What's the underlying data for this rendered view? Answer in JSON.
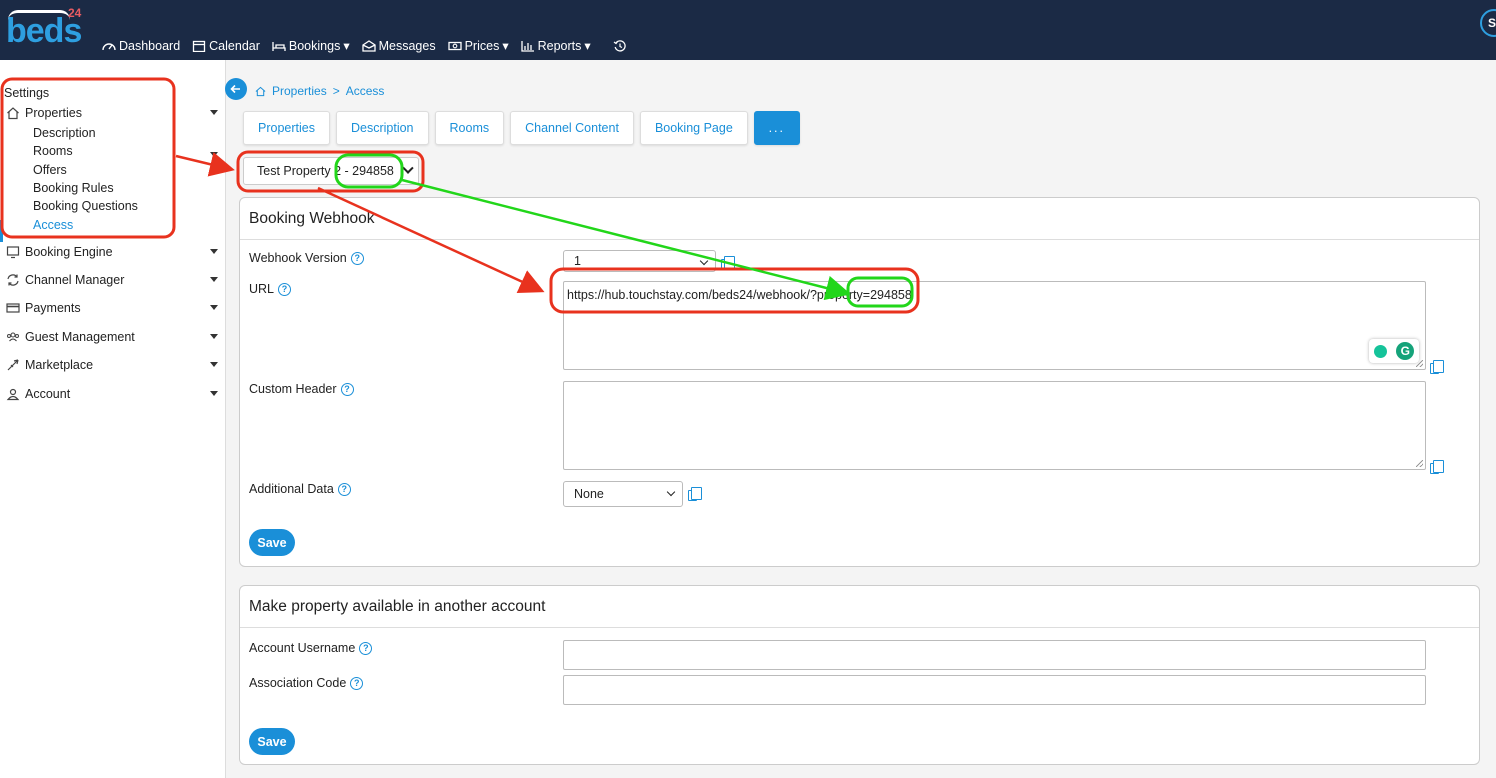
{
  "app": {
    "logo_text": "beds",
    "logo_sup": "24",
    "user_initial": "S"
  },
  "nav": {
    "dashboard": "Dashboard",
    "calendar": "Calendar",
    "bookings": "Bookings",
    "messages": "Messages",
    "prices": "Prices",
    "reports": "Reports"
  },
  "sidebar": {
    "settings": "Settings",
    "properties": "Properties",
    "sub": [
      "Description",
      "Rooms",
      "Offers",
      "Booking Rules",
      "Booking Questions",
      "Access"
    ],
    "booking_engine": "Booking Engine",
    "channel_manager": "Channel Manager",
    "payments": "Payments",
    "guest_management": "Guest Management",
    "marketplace": "Marketplace",
    "account": "Account"
  },
  "breadcrumb": {
    "properties": "Properties",
    "sep": ">",
    "access": "Access"
  },
  "tabs": [
    "Properties",
    "Description",
    "Rooms",
    "Channel Content",
    "Booking Page",
    "..."
  ],
  "property_select": {
    "label": "Test Property 2 - 294858"
  },
  "webhook": {
    "title": "Booking Webhook",
    "version_label": "Webhook Version",
    "version_value": "1",
    "url_label": "URL",
    "url_value": "https://hub.touchstay.com/beds24/webhook/?property=294858",
    "custom_header_label": "Custom Header",
    "additional_data_label": "Additional Data",
    "additional_data_value": "None",
    "save": "Save"
  },
  "association": {
    "title": "Make property available in another account",
    "username_label": "Account Username",
    "code_label": "Association Code",
    "save": "Save"
  },
  "help_glyph": "?",
  "colors": {
    "topbar": "#1b2a45",
    "accent": "#1a8fd8",
    "annotation_red": "#e8321e",
    "annotation_green": "#22d61a"
  }
}
